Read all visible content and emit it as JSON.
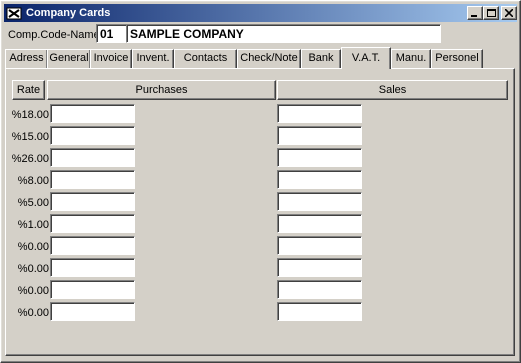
{
  "window": {
    "title": "Company Cards",
    "app_icon": "company-app-icon"
  },
  "company": {
    "label": "Comp.Code-Name",
    "code": "01",
    "name": "SAMPLE COMPANY"
  },
  "tabs": [
    {
      "label": "Adress",
      "active": false
    },
    {
      "label": "General",
      "active": false
    },
    {
      "label": "Invoice",
      "active": false
    },
    {
      "label": "Invent.",
      "active": false
    },
    {
      "label": "Contacts",
      "active": false
    },
    {
      "label": "Check/Note",
      "active": false
    },
    {
      "label": "Bank",
      "active": false
    },
    {
      "label": "V.A.T.",
      "active": true
    },
    {
      "label": "Manu.",
      "active": false
    },
    {
      "label": "Personel",
      "active": false
    }
  ],
  "vat": {
    "headers": {
      "rate": "Rate",
      "purchases": "Purchases",
      "sales": "Sales"
    },
    "rows": [
      {
        "rate": "%18.00",
        "purchases": "",
        "sales": ""
      },
      {
        "rate": "%15.00",
        "purchases": "",
        "sales": ""
      },
      {
        "rate": "%26.00",
        "purchases": "",
        "sales": ""
      },
      {
        "rate": "%8.00",
        "purchases": "",
        "sales": ""
      },
      {
        "rate": "%5.00",
        "purchases": "",
        "sales": ""
      },
      {
        "rate": "%1.00",
        "purchases": "",
        "sales": ""
      },
      {
        "rate": "%0.00",
        "purchases": "",
        "sales": ""
      },
      {
        "rate": "%0.00",
        "purchases": "",
        "sales": ""
      },
      {
        "rate": "%0.00",
        "purchases": "",
        "sales": ""
      },
      {
        "rate": "%0.00",
        "purchases": "",
        "sales": ""
      }
    ]
  }
}
